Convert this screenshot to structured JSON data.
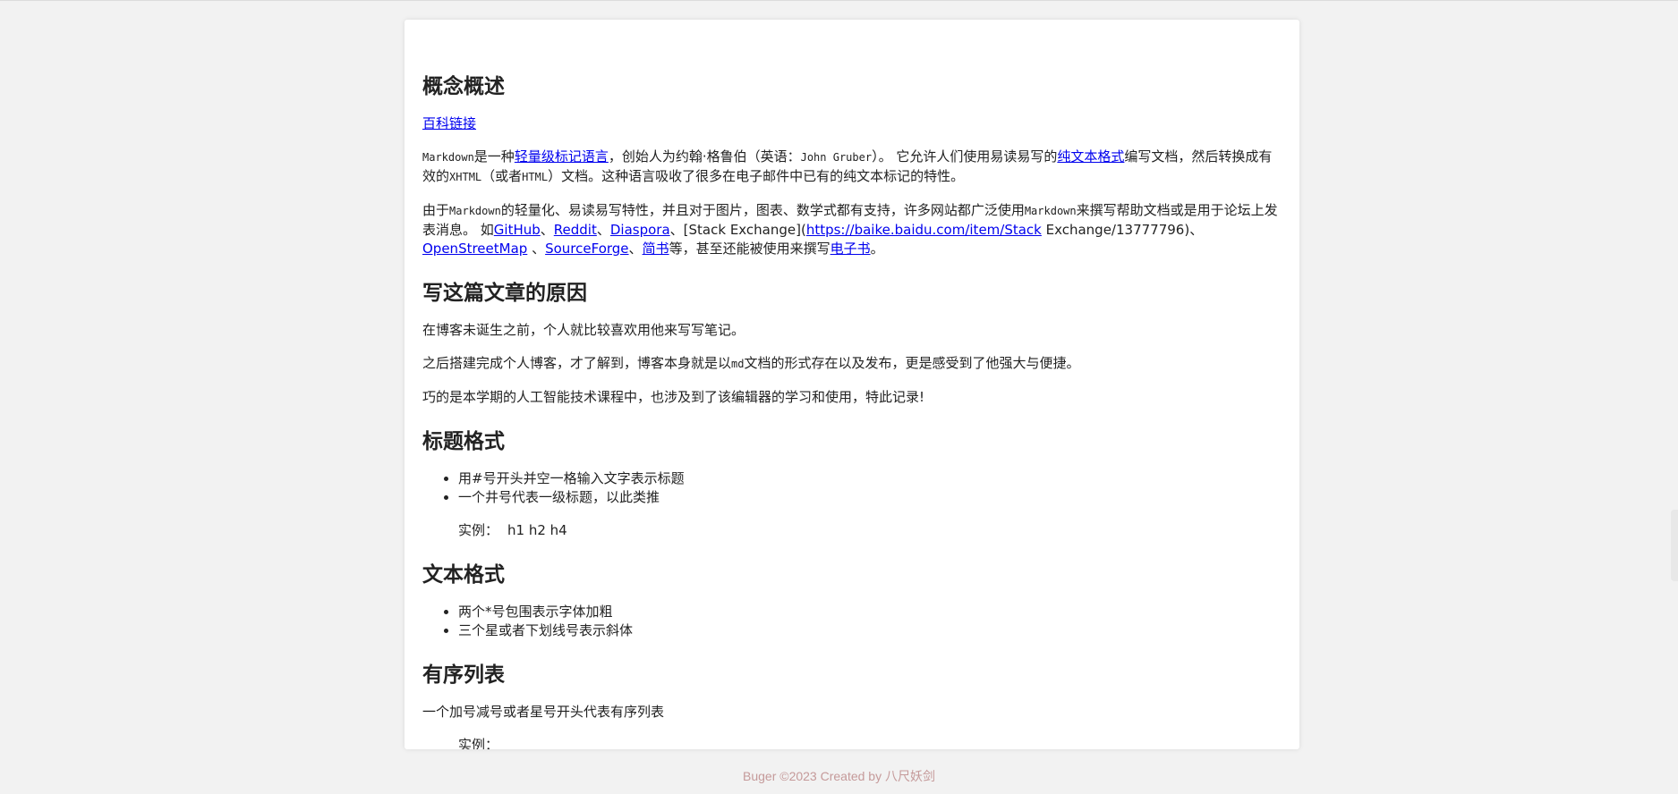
{
  "sections": {
    "concept": {
      "title": "概念概述",
      "baike_link": "百科链接",
      "p1": {
        "t1": "Markdown",
        "t2": "是一种",
        "link1": "轻量级标记语言",
        "t3": "，创始人为约翰·格鲁伯（英语：",
        "t4": "John Gruber",
        "t5": "）。 它允许人们使用易读易写的",
        "link2": "纯文本格式",
        "t6": "编写文档，然后转换成有效的",
        "t7": "XHTML",
        "t8": "（或者",
        "t9": "HTML",
        "t10": "）文档。这种语言吸收了很多在电子邮件中已有的纯文本标记的特性。"
      },
      "p2": {
        "t1": "由于",
        "t2": "Markdown",
        "t3": "的轻量化、易读易写特性，并且对于图片，图表、数学式都有支持，许多网站都广泛使用",
        "t4": "Markdown",
        "t5": "来撰写帮助文档或是用于论坛上发表消息。 如",
        "l_github": "GitHub",
        "s1": "、",
        "l_reddit": "Reddit",
        "s2": "、",
        "l_diaspora": "Diaspora",
        "s3": "、[Stack Exchange](",
        "l_baidu": "https://baike.baidu.com/item/Stack",
        "s4": " Exchange/13777796)、",
        "l_osm": "OpenStreetMap",
        "s5": " 、",
        "l_sf": "SourceForge",
        "s6": "、",
        "l_jianshu": "简书",
        "s7": "等，甚至还能被使用来撰写",
        "l_ebook": "电子书",
        "s8": "。"
      }
    },
    "reason": {
      "title": "写这篇文章的原因",
      "p1": "在博客未诞生之前，个人就比较喜欢用他来写写笔记。",
      "p2": {
        "t1": "之后搭建完成个人博客，才了解到，博客本身就是以",
        "t2": "md",
        "t3": "文档的形式存在以及发布，更是感受到了他强大与便捷。"
      },
      "p3": "巧的是本学期的人工智能技术课程中，也涉及到了该编辑器的学习和使用，特此记录!"
    },
    "heading_format": {
      "title": "标题格式",
      "items": [
        "用#号开头并空一格输入文字表示标题",
        "一个井号代表一级标题，以此类推"
      ],
      "example_label": "实例：",
      "example_content": "h1 h2 h4"
    },
    "text_format": {
      "title": "文本格式",
      "items": [
        "两个*号包围表示字体加粗",
        "三个星或者下划线号表示斜体"
      ]
    },
    "ordered_list": {
      "title": "有序列表",
      "p1": "一个加号减号或者星号开头代表有序列表",
      "example_label": "实例："
    }
  },
  "footer": {
    "text": "Buger ©2023 Created by 八尺妖剑"
  }
}
